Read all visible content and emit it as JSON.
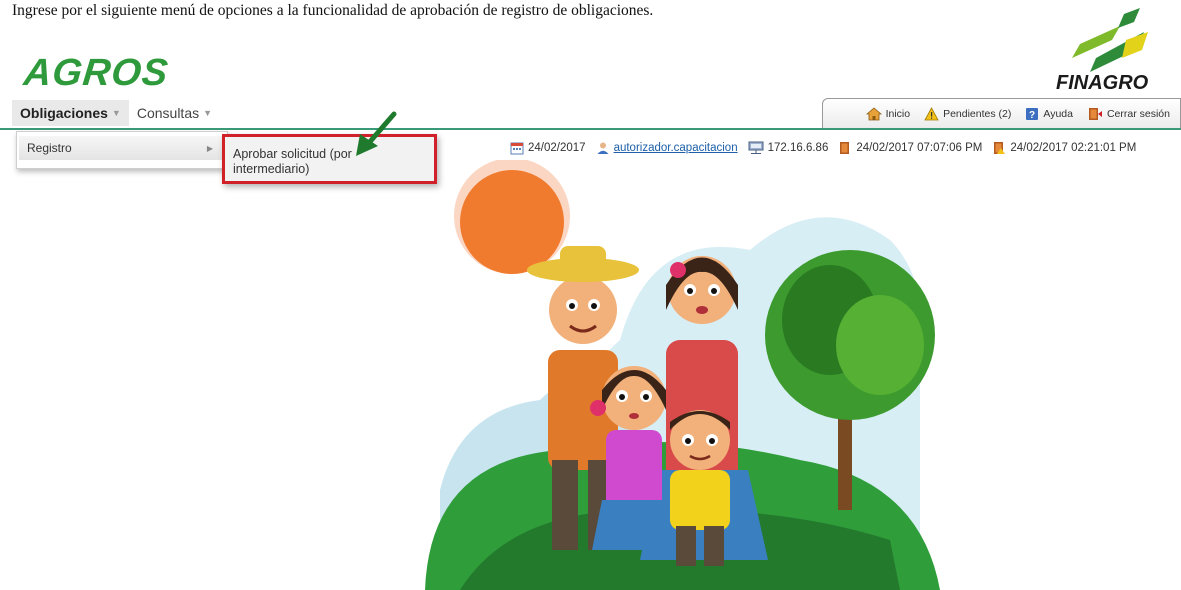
{
  "caption": "Ingrese por el siguiente menú de opciones a la funcionalidad de aprobación de registro de obligaciones.",
  "logos": {
    "agros": "AGROS",
    "finagro": "FINAGRO"
  },
  "menubar": {
    "obligaciones": "Obligaciones",
    "consultas": "Consultas"
  },
  "tabs": {
    "inicio": "Inicio",
    "pendientes": "Pendientes (2)",
    "ayuda": "Ayuda",
    "cerrar": "Cerrar sesión"
  },
  "submenu": {
    "registro": "Registro"
  },
  "flyout": {
    "aprobar": "Aprobar solicitud (por intermediario)"
  },
  "infobar": {
    "date": "24/02/2017",
    "user": "autorizador.capacitacion",
    "ip": "172.16.6.86",
    "session_start": "24/02/2017 07:07:06 PM",
    "last_access": "24/02/2017 02:21:01 PM"
  },
  "colors": {
    "accent_green": "#3a9a78",
    "highlight_red": "#d0202a",
    "brand_green": "#2e9a3c"
  }
}
